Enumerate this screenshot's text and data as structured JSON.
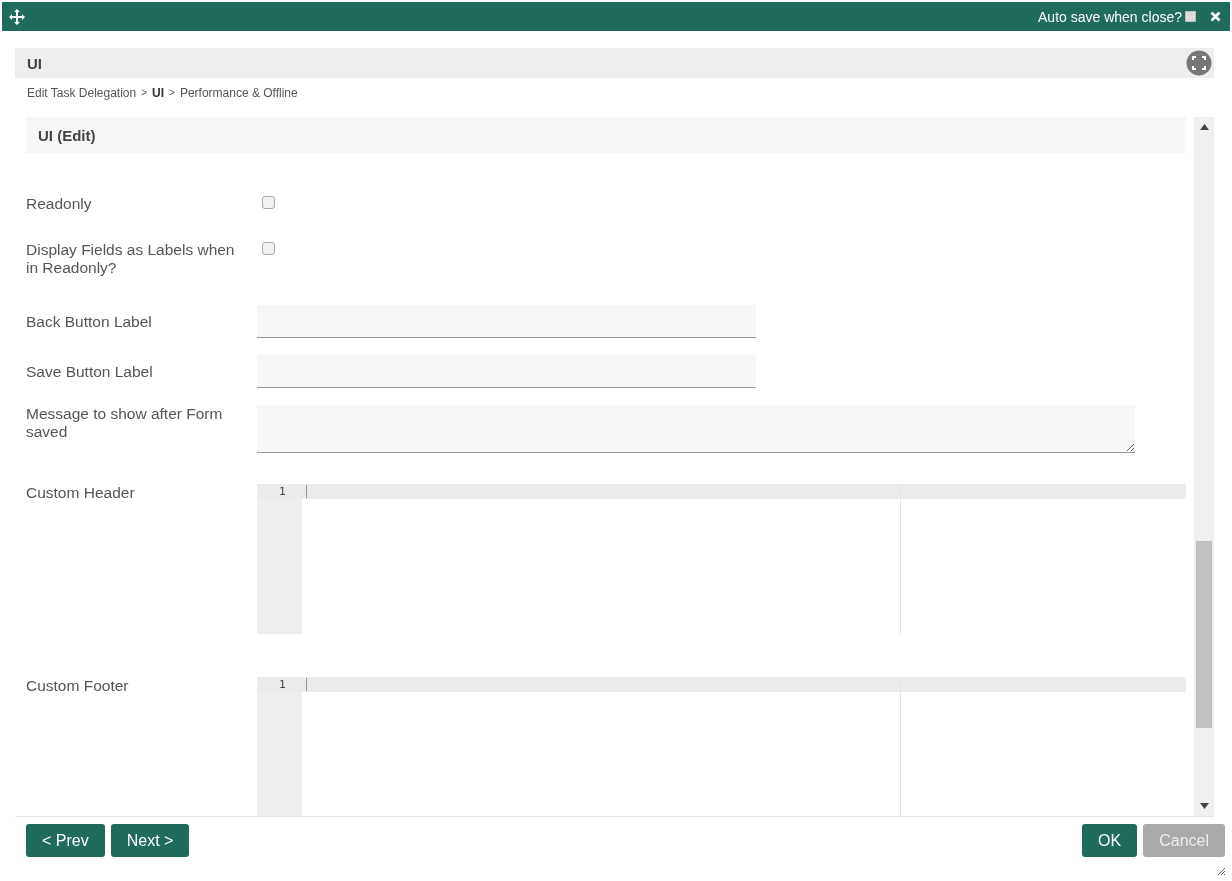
{
  "window": {
    "autosave_label": "Auto save when close?",
    "autosave_checked": false
  },
  "panel": {
    "title": "UI"
  },
  "breadcrumb": [
    {
      "kind": "link",
      "label": "Edit Task Delegation"
    },
    {
      "kind": "separator",
      "label": ">"
    },
    {
      "kind": "current",
      "label": "UI"
    },
    {
      "kind": "separator",
      "label": ">"
    },
    {
      "kind": "link",
      "label": "Performance & Offline"
    }
  ],
  "section": {
    "title": "UI (Edit)"
  },
  "fields": [
    {
      "kind": "checkbox",
      "label": "Readonly",
      "checked": false
    },
    {
      "kind": "checkbox",
      "label": "Display Fields as Labels when in Readonly?",
      "checked": false
    },
    {
      "kind": "text",
      "label": "Back Button Label"
    },
    {
      "kind": "text",
      "label": "Save Button Label"
    },
    {
      "kind": "textarea",
      "label": "Message to show after Form saved"
    },
    {
      "kind": "code",
      "label": "Custom Header",
      "line_number": "1"
    },
    {
      "kind": "code",
      "label": "Custom Footer",
      "line_number": "1"
    }
  ],
  "nav_buttons": [
    {
      "label": "< Prev",
      "disabled": false
    },
    {
      "label": "Next >",
      "disabled": false
    }
  ],
  "dialog_buttons": [
    {
      "label": "OK",
      "disabled": false
    },
    {
      "label": "Cancel",
      "disabled": true
    }
  ]
}
